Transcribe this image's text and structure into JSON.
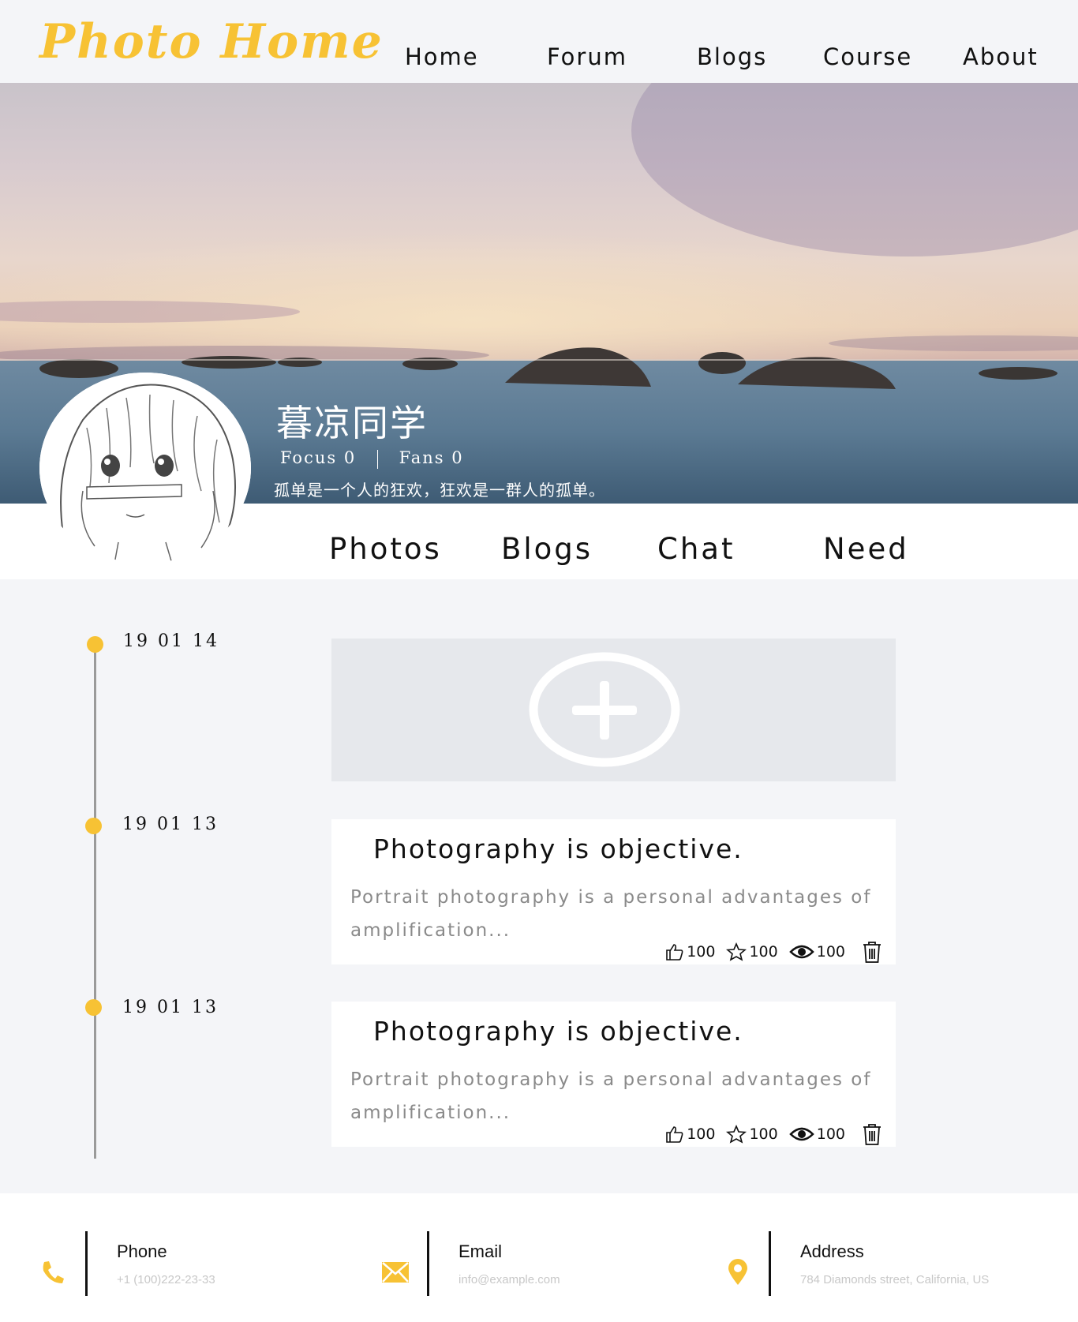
{
  "header": {
    "logo": "Photo Home",
    "nav": [
      "Home",
      "Forum",
      "Blogs",
      "Course",
      "About"
    ]
  },
  "profile": {
    "name": "暮凉同学",
    "focus_label": "Focus",
    "focus_count": "0",
    "fans_label": "Fans",
    "fans_count": "0",
    "motto": "孤单是一个人的狂欢，狂欢是一群人的孤单。"
  },
  "subnav": [
    "Photos",
    "Blogs",
    "Chat",
    "Need"
  ],
  "timeline": [
    {
      "date": "19 01 14",
      "type": "add"
    },
    {
      "date": "19 01 13",
      "type": "post",
      "title": "Photography is objective.",
      "excerpt": "Portrait photography is a personal advantages of amplification...",
      "likes": "100",
      "stars": "100",
      "views": "100"
    },
    {
      "date": "19 01 13",
      "type": "post",
      "title": "Photography is objective.",
      "excerpt": "Portrait photography is a personal advantages of amplification...",
      "likes": "100",
      "stars": "100",
      "views": "100"
    }
  ],
  "footer": {
    "phone": {
      "title": "Phone",
      "value": "+1 (100)222-23-33"
    },
    "email": {
      "title": "Email",
      "value": "info@example.com"
    },
    "address": {
      "title": "Address",
      "value": "784 Diamonds street, California, US"
    }
  },
  "colors": {
    "accent": "#f7c234",
    "background": "#f4f5f8",
    "add_card": "#e6e8ec"
  },
  "icons": [
    "plus-circle-icon",
    "thumbs-up-icon",
    "star-icon",
    "eye-icon",
    "trash-icon",
    "phone-icon",
    "envelope-icon",
    "location-pin-icon"
  ]
}
